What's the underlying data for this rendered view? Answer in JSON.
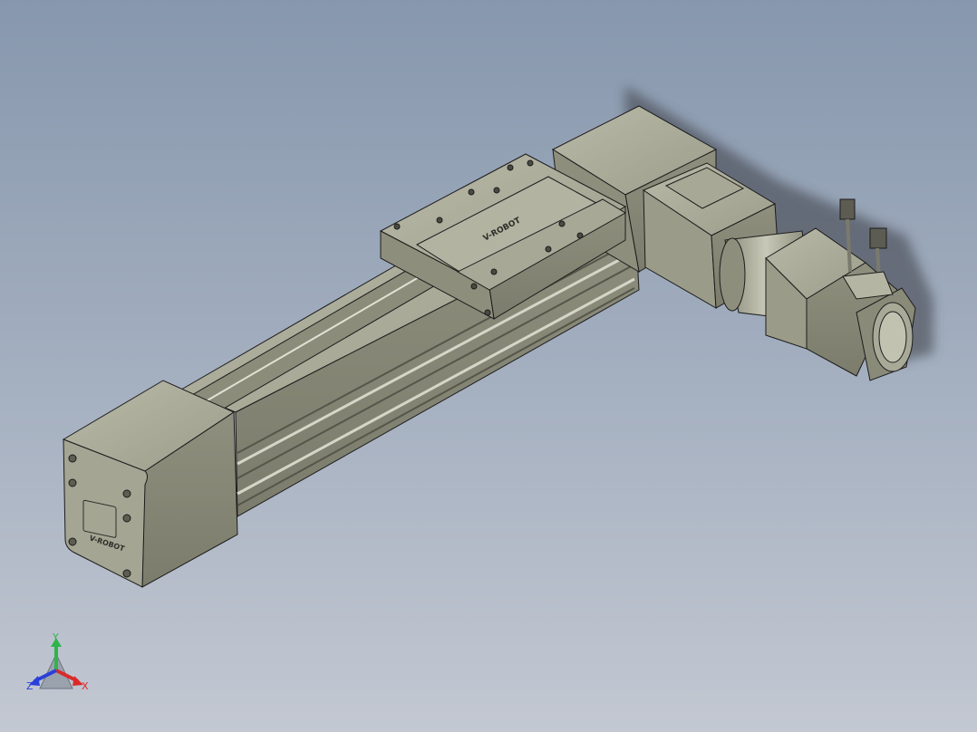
{
  "viewport": {
    "background_top": "#8797ad",
    "background_bottom": "#c3c8d2",
    "model": {
      "part_color": "#a3a391",
      "edge_color": "#1c1c1c",
      "logo_text_end_plate": "V-ROBOT",
      "logo_text_carriage": "V-ROBOT"
    },
    "triad": {
      "x_label": "X",
      "y_label": "Y",
      "z_label": "Z",
      "x_color": "#d92a2a",
      "y_color": "#2fb44a",
      "z_color": "#2a3fd9"
    }
  }
}
